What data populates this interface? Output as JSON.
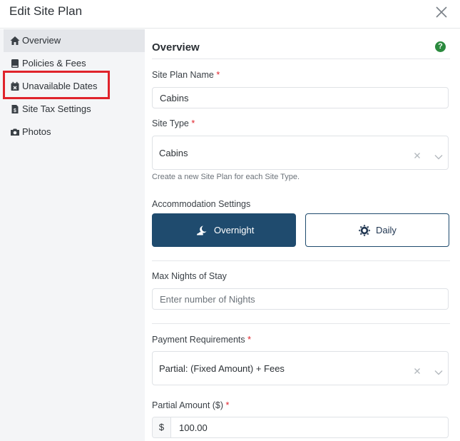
{
  "header": {
    "title": "Edit Site Plan"
  },
  "sidebar": {
    "items": [
      {
        "label": "Overview",
        "icon": "home-icon",
        "active": true
      },
      {
        "label": "Policies & Fees",
        "icon": "book-icon",
        "active": false
      },
      {
        "label": "Unavailable Dates",
        "icon": "calendar-x-icon",
        "active": false
      },
      {
        "label": "Site Tax Settings",
        "icon": "invoice-dollar-icon",
        "active": false
      },
      {
        "label": "Photos",
        "icon": "camera-icon",
        "active": false
      }
    ]
  },
  "main": {
    "title": "Overview",
    "help_icon": "?",
    "site_plan_name": {
      "label": "Site Plan Name",
      "required_mark": "*",
      "value": "Cabins"
    },
    "site_type": {
      "label": "Site Type",
      "required_mark": "*",
      "value": "Cabins",
      "helper": "Create a new Site Plan for each Site Type."
    },
    "accommodation": {
      "label": "Accommodation Settings",
      "options": [
        "Overnight",
        "Daily"
      ],
      "selected": "Overnight"
    },
    "max_nights": {
      "label": "Max Nights of Stay",
      "placeholder": "Enter number of Nights"
    },
    "payment_requirements": {
      "label": "Payment Requirements",
      "required_mark": "*",
      "value": "Partial: (Fixed Amount) + Fees"
    },
    "partial_amount": {
      "label": "Partial Amount ($)",
      "required_mark": "*",
      "prefix": "$",
      "value": "100.00"
    }
  },
  "colors": {
    "primary": "#1f4b6e",
    "help_green": "#2b8a3e",
    "required_red": "#e0232b",
    "highlight_red": "#e0232b",
    "sidebar_bg": "#f4f5f7"
  }
}
